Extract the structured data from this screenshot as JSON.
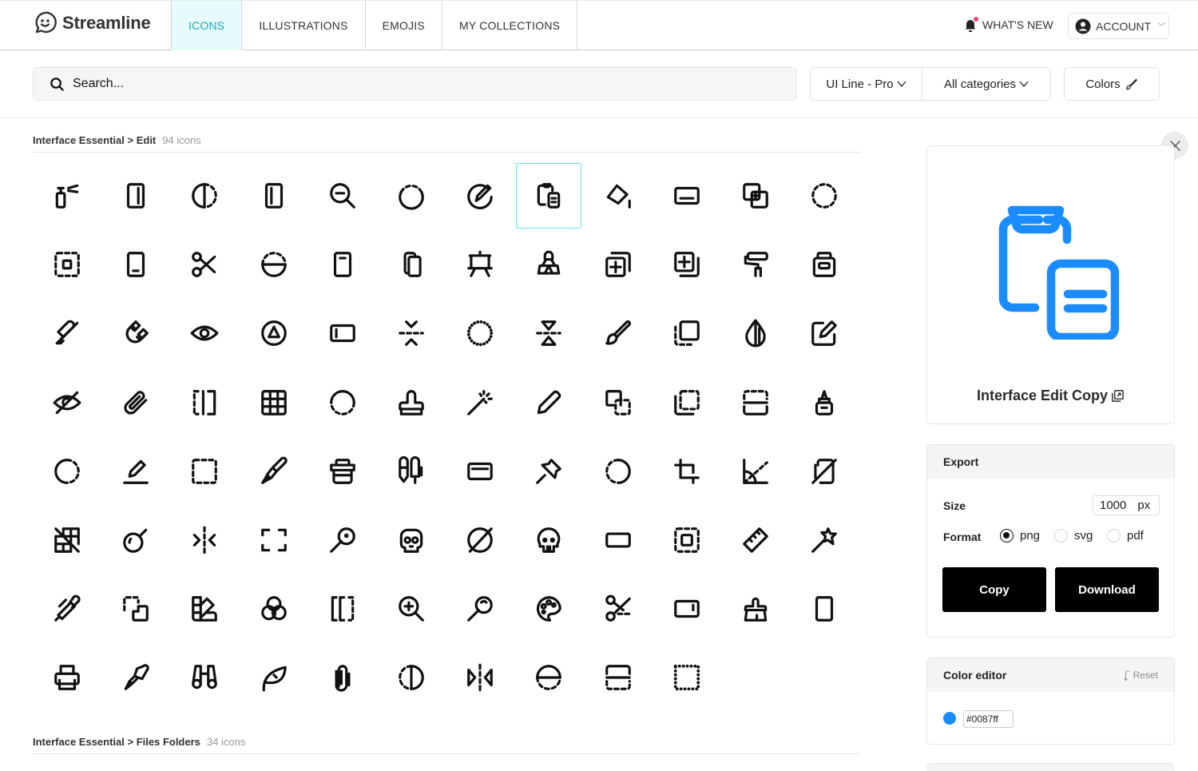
{
  "brand": {
    "name": "Streamline",
    "logo_icon": "smiley-chat-icon"
  },
  "nav": {
    "tabs": [
      {
        "label": "ICONS",
        "active": true
      },
      {
        "label": "ILLUSTRATIONS",
        "active": false
      },
      {
        "label": "EMOJIS",
        "active": false
      },
      {
        "label": "MY COLLECTIONS",
        "active": false
      }
    ],
    "whats_new": "WHAT'S NEW",
    "account": "ACCOUNT"
  },
  "search": {
    "placeholder": "Search...",
    "value": ""
  },
  "filters": {
    "style": "UI Line - Pro",
    "category": "All categories",
    "colors": "Colors"
  },
  "sections": [
    {
      "breadcrumb": "Interface Essential > Edit",
      "count": "94 icons",
      "icons": [
        "spray-bottle",
        "layout-right-panel",
        "half-circle-dashed",
        "layout-left-panel",
        "zoom-out",
        "circle-dashed-top",
        "sign-pen-circle",
        "edit-copy",
        "paint-bucket",
        "keyboard-bar",
        "copy-dashed-add",
        "circle-dashed",
        "dashed-square-focus",
        "mobile-bottom-bar",
        "scissors",
        "half-circle-bottom",
        "mobile-top-bar",
        "copy-pages",
        "easel",
        "binder-clip",
        "add-layer-front",
        "add-layer-back",
        "paint-roller",
        "ink-bottle",
        "eyedropper",
        "magnet",
        "eye",
        "circle-triangle",
        "layout-left-bar",
        "merge-vertical",
        "circle-dotted",
        "flip-vertical",
        "paint-brush",
        "dashed-square-back",
        "water-drop-half",
        "edit-square",
        "eye-off",
        "paperclip",
        "brackets-dashed",
        "grid-table",
        "circle-dashed-bottom",
        "stamp",
        "magic-wand",
        "pencil",
        "copy-dashed-front",
        "dashed-corner",
        "split-dashed-top",
        "glue-bottle",
        "circle-dashed-right",
        "pencil-underline",
        "dashed-square",
        "fountain-pen",
        "printer-stack",
        "pens",
        "card-top-bar",
        "push-pin",
        "circle-dashed-left",
        "crop",
        "angle",
        "copy-slash",
        "grid-slash",
        "bomb",
        "split-horizontal",
        "frame-corners",
        "magnifier-dot",
        "skull-square",
        "circle-slash",
        "skull",
        "rectangle",
        "dashed-square-center",
        "ruler",
        "star-wand",
        "pen-slanted",
        "dashed-back-corner",
        "color-swatches",
        "color-circles",
        "brackets-half-dashed",
        "zoom-in",
        "magnifier-arc",
        "palette",
        "cut-dashed",
        "tablet-side-bar",
        "brush-broom",
        "mobile-portrait",
        "printer",
        "cutter",
        "binoculars",
        "leaf",
        "paperclip-vertical",
        "half-circle-left-dashed",
        "mirror-horizontal",
        "half-circle-top",
        "split-dashed-bottom",
        "dotted-square"
      ],
      "selected_index": 7
    },
    {
      "breadcrumb": "Interface Essential > Files Folders",
      "count": "34 icons"
    }
  ],
  "preview": {
    "title": "Interface Edit Copy",
    "icon": "edit-copy",
    "color": "#1a8cff"
  },
  "export": {
    "heading": "Export",
    "size_label": "Size",
    "size_value": "1000",
    "size_unit": "px",
    "format_label": "Format",
    "formats": [
      {
        "label": "png",
        "checked": true
      },
      {
        "label": "svg",
        "checked": false
      },
      {
        "label": "pdf",
        "checked": false
      }
    ],
    "copy": "Copy",
    "download": "Download"
  },
  "color_editor": {
    "heading": "Color editor",
    "reset": "Reset",
    "color": "#0087ff"
  },
  "accent": {
    "active_tab_bg": "#e5fbfc",
    "active_tab_text": "#1fa8ae",
    "selected_border": "#6ee4e6",
    "notification": "#f0457a"
  }
}
